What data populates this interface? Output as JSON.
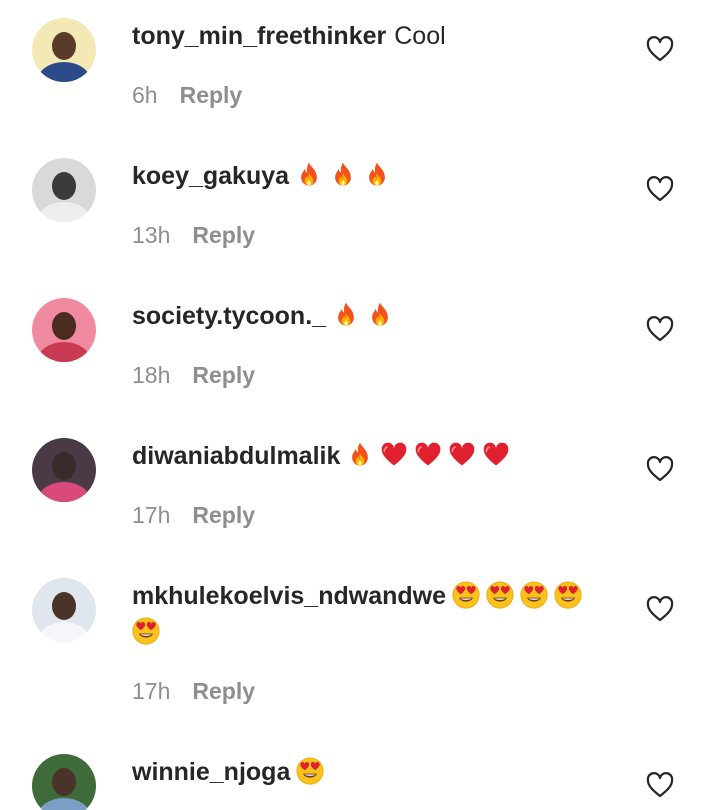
{
  "comments": [
    {
      "username": "tony_min_freethinker",
      "text": "Cool",
      "emojis": [],
      "time": "6h",
      "reply_label": "Reply",
      "avatar_colors": {
        "bg": "#f2e9b5",
        "face": "#5a3b2a",
        "shirt": "#2c4a8a"
      }
    },
    {
      "username": "koey_gakuya",
      "text": "",
      "emojis": [
        "fire",
        "fire",
        "fire"
      ],
      "time": "13h",
      "reply_label": "Reply",
      "avatar_colors": {
        "bg": "#d9d9d9",
        "face": "#3a3a3a",
        "shirt": "#eeeeee"
      }
    },
    {
      "username": "society.tycoon._",
      "text": "",
      "emojis": [
        "fire",
        "fire"
      ],
      "time": "18h",
      "reply_label": "Reply",
      "avatar_colors": {
        "bg": "#f08aa0",
        "face": "#4a2a22",
        "shirt": "#c93a52"
      }
    },
    {
      "username": "diwaniabdulmalik",
      "text": "",
      "emojis": [
        "fire",
        "red-heart",
        "red-heart",
        "red-heart",
        "red-heart"
      ],
      "time": "17h",
      "reply_label": "Reply",
      "avatar_colors": {
        "bg": "#4a3a46",
        "face": "#3a2a2a",
        "shirt": "#d94a7a"
      }
    },
    {
      "username": "mkhulekoelvis_ndwandwe",
      "text": "",
      "emojis": [
        "heart-eyes",
        "heart-eyes",
        "heart-eyes",
        "heart-eyes",
        "heart-eyes"
      ],
      "time": "17h",
      "reply_label": "Reply",
      "avatar_colors": {
        "bg": "#dfe6ee",
        "face": "#4a3328",
        "shirt": "#f4f6fa"
      }
    },
    {
      "username": "winnie_njoga",
      "text": "",
      "emojis": [
        "heart-eyes"
      ],
      "time": "",
      "reply_label": "",
      "avatar_colors": {
        "bg": "#3f6a3a",
        "face": "#4a3328",
        "shirt": "#7aa0c8"
      }
    }
  ],
  "colors": {
    "username": "#262626",
    "meta": "#8e8e8e",
    "like_outline": "#262626"
  },
  "icons": {
    "like": "heart-outline-icon"
  }
}
